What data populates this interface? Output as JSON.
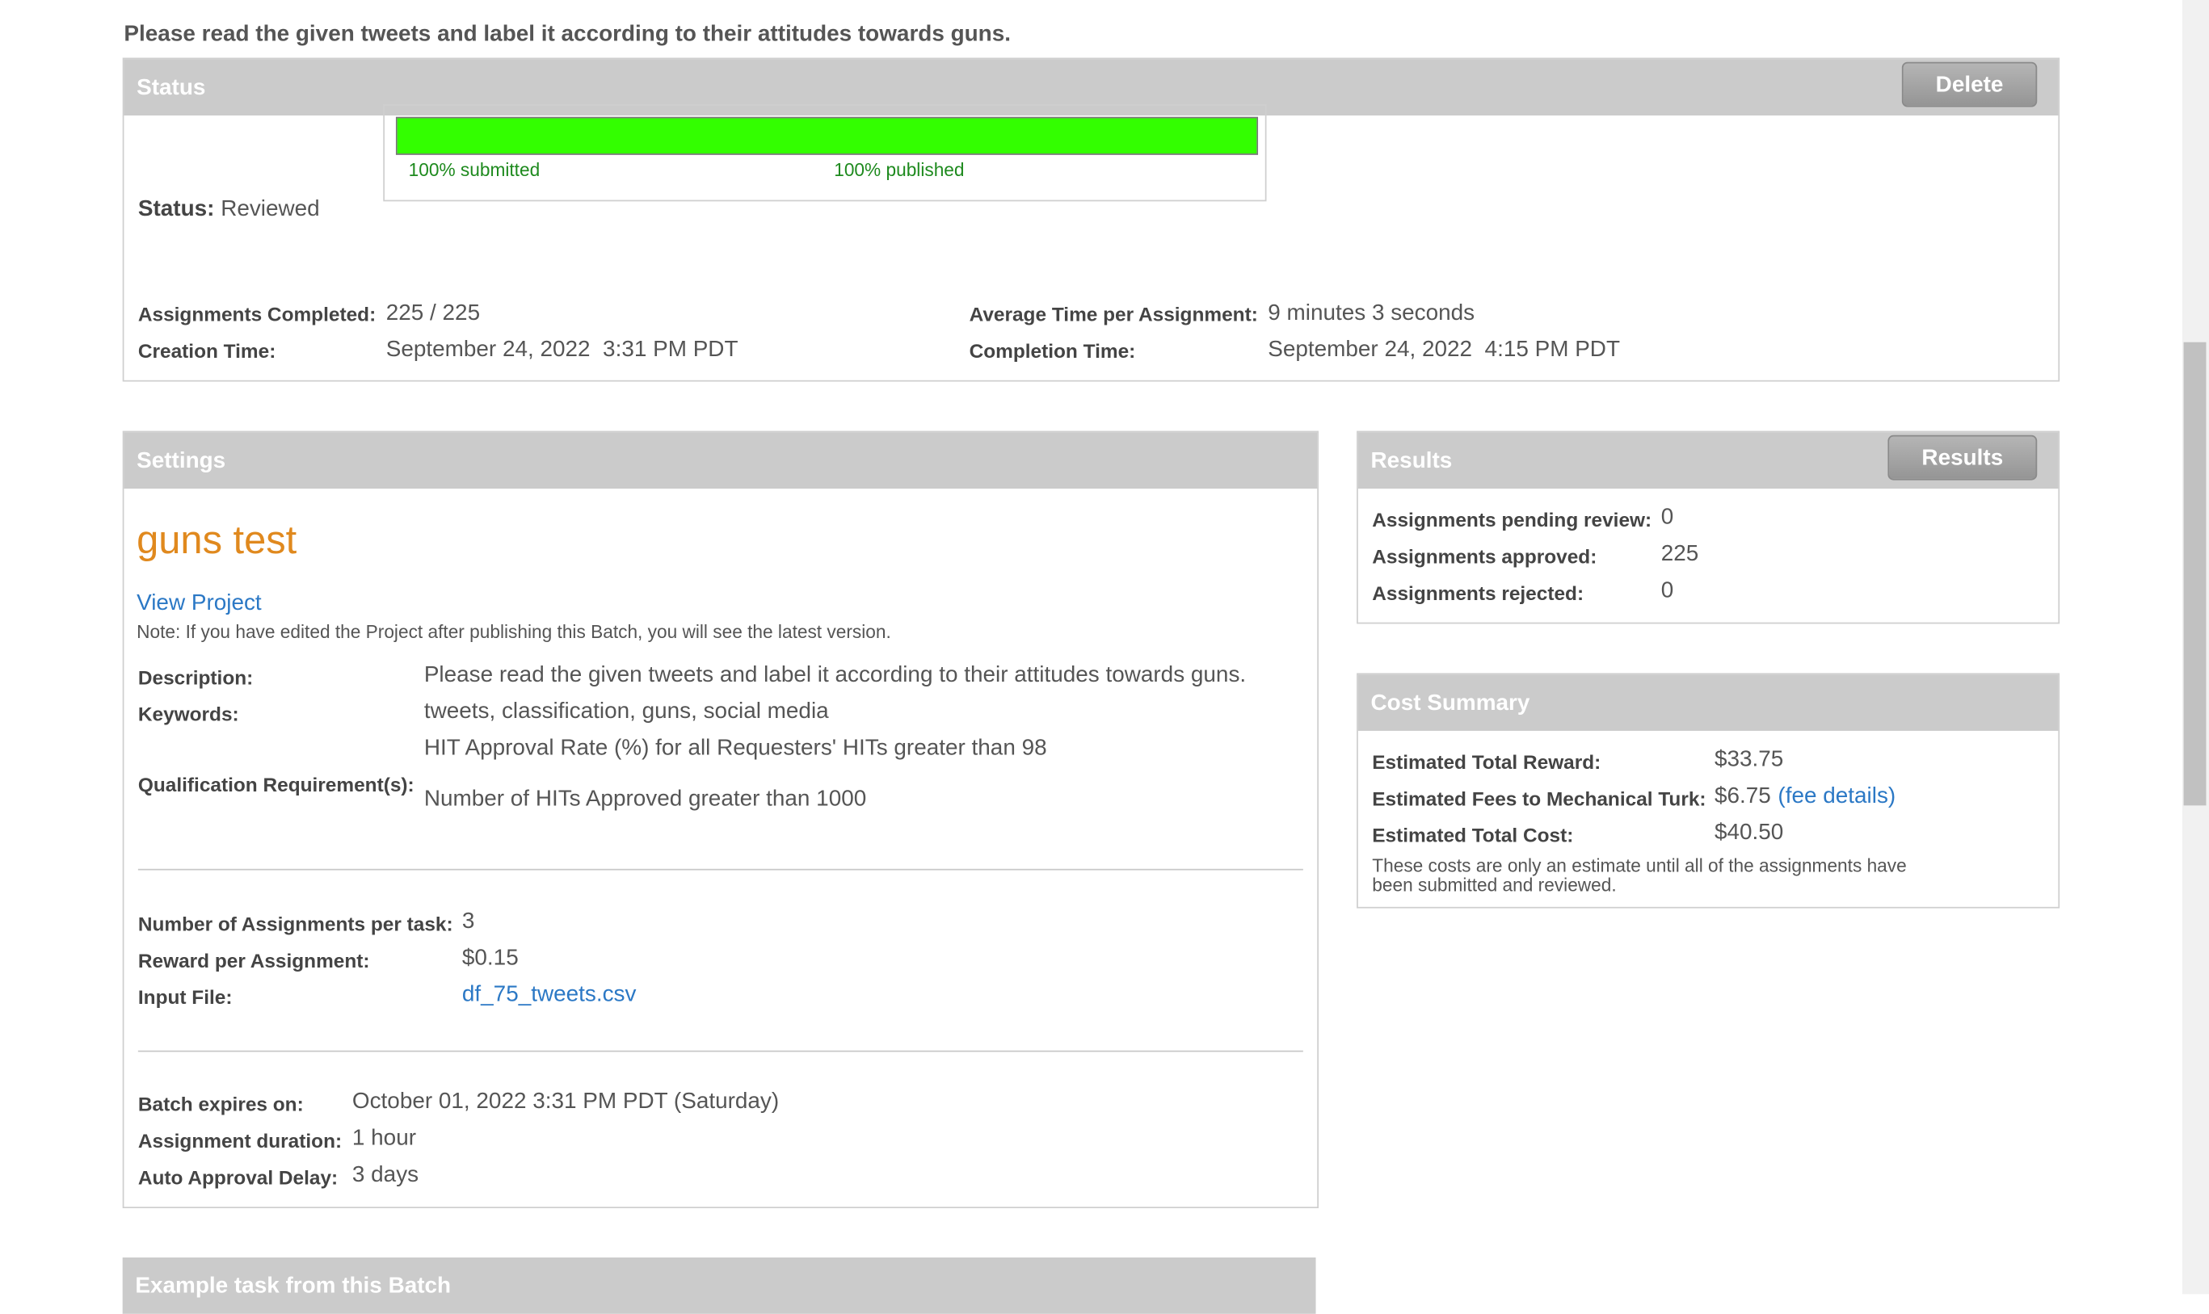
{
  "page": {
    "heading": "Please read the given tweets and label it according to their attitudes towards guns."
  },
  "status_panel": {
    "title": "Status",
    "delete_label": "Delete",
    "status_label": "Status:",
    "status_value": "Reviewed",
    "progress": {
      "fraction": 1.0,
      "submitted_text": "100% submitted",
      "published_text": "100% published",
      "fill_color": "#33ff00"
    },
    "assignments_completed_label": "Assignments Completed:",
    "assignments_completed_value": "225 / 225",
    "creation_time_label": "Creation Time:",
    "creation_time_value": "September 24, 2022  3:31 PM PDT",
    "avg_time_label": "Average Time per Assignment:",
    "avg_time_value": "9 minutes 3 seconds",
    "completion_time_label": "Completion Time:",
    "completion_time_value": "September 24, 2022  4:15 PM PDT"
  },
  "settings": {
    "title": "Settings",
    "project_name": "guns test",
    "view_project": "View Project",
    "note": "Note: If you have edited the Project after publishing this Batch, you will see the latest version.",
    "description_label": "Description:",
    "description_value": "Please read the given tweets and label it according to their attitudes towards guns.",
    "keywords_label": "Keywords:",
    "keywords_value": "tweets, classification, guns, social media",
    "qualification_label": "Qualification Requirement(s):",
    "qualification_values": [
      "HIT Approval Rate (%) for all Requesters' HITs greater than 98",
      "Number of HITs Approved greater than 1000"
    ],
    "assignments_per_task_label": "Number of Assignments per task:",
    "assignments_per_task_value": "3",
    "reward_label": "Reward per Assignment:",
    "reward_value": "$0.15",
    "input_file_label": "Input File:",
    "input_file_value": "df_75_tweets.csv",
    "expires_label": "Batch expires on:",
    "expires_value": "October 01, 2022 3:31 PM PDT (Saturday)",
    "duration_label": "Assignment duration:",
    "duration_value": "1 hour",
    "auto_approval_label": "Auto Approval Delay:",
    "auto_approval_value": "3 days"
  },
  "results": {
    "title": "Results",
    "button_label": "Results",
    "pending_label": "Assignments pending review:",
    "pending_value": "0",
    "approved_label": "Assignments approved:",
    "approved_value": "225",
    "rejected_label": "Assignments rejected:",
    "rejected_value": "0"
  },
  "cost": {
    "title": "Cost Summary",
    "reward_label": "Estimated Total Reward:",
    "reward_value": "$33.75",
    "fees_label": "Estimated Fees to Mechanical Turk:",
    "fees_value": "$6.75",
    "fee_details": "(fee details)",
    "total_label": "Estimated Total Cost:",
    "total_value": "$40.50",
    "note_line1": "These costs are only an estimate until all of the assignments have",
    "note_line2": "been submitted and reviewed."
  },
  "example": {
    "title": "Example task from this Batch"
  }
}
